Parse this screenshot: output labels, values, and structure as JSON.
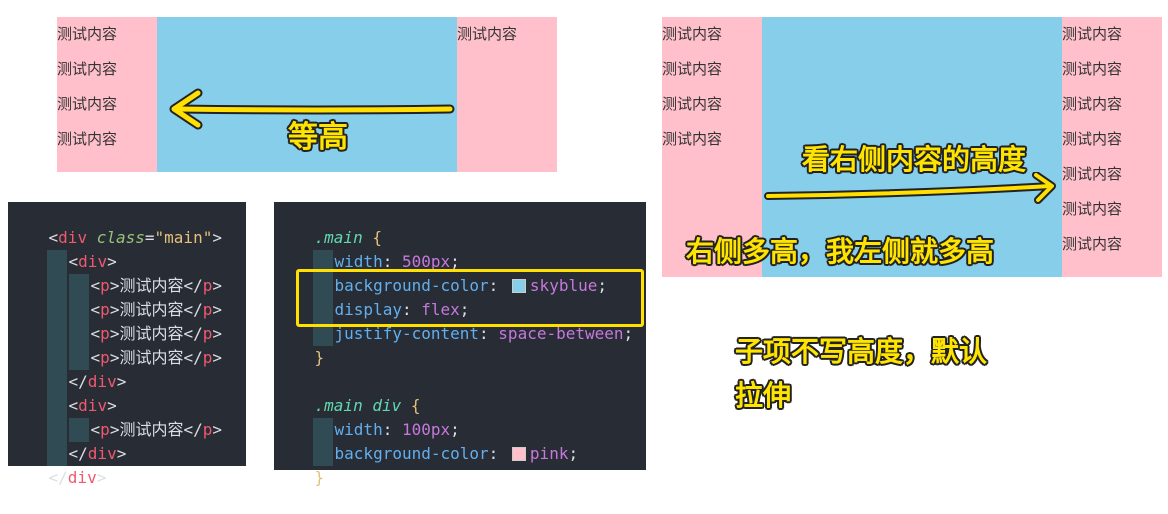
{
  "demo1": {
    "left_items": [
      "测试内容",
      "测试内容",
      "测试内容",
      "测试内容"
    ],
    "right_items": [
      "测试内容"
    ]
  },
  "demo2": {
    "left_items": [
      "测试内容",
      "测试内容",
      "测试内容",
      "测试内容"
    ],
    "right_items": [
      "测试内容",
      "测试内容",
      "测试内容",
      "测试内容",
      "测试内容",
      "测试内容",
      "测试内容"
    ]
  },
  "notes": {
    "equal_height": "等高",
    "look_right": "看右侧内容的高度",
    "right_tall": "右侧多高，我左侧就多高",
    "no_height_line1": "子项不写高度，默认",
    "no_height_line2": "拉伸"
  },
  "html_code": {
    "l1_open": "<",
    "l1_tag": "div",
    "l1_attr": "class",
    "l1_eq": "=",
    "l1_str": "\"main\"",
    "l1_close": ">",
    "p_text": "测试内容",
    "div": "div",
    "p": "p"
  },
  "css_code": {
    "main_sel": ".main",
    "main_div_sel": ".main div",
    "width_prop": "width",
    "width_val_500": "500px",
    "bg_prop": "background-color",
    "bg_skyblue": "skyblue",
    "display_prop": "display",
    "display_val": "flex",
    "jc_prop": "justify-content",
    "jc_val": "space-between",
    "width_val_100": "100px",
    "bg_pink": "pink",
    "colors": {
      "skyblue": "#87ceeb",
      "pink": "#ffc0cb",
      "highlight": "#ffe000"
    }
  }
}
